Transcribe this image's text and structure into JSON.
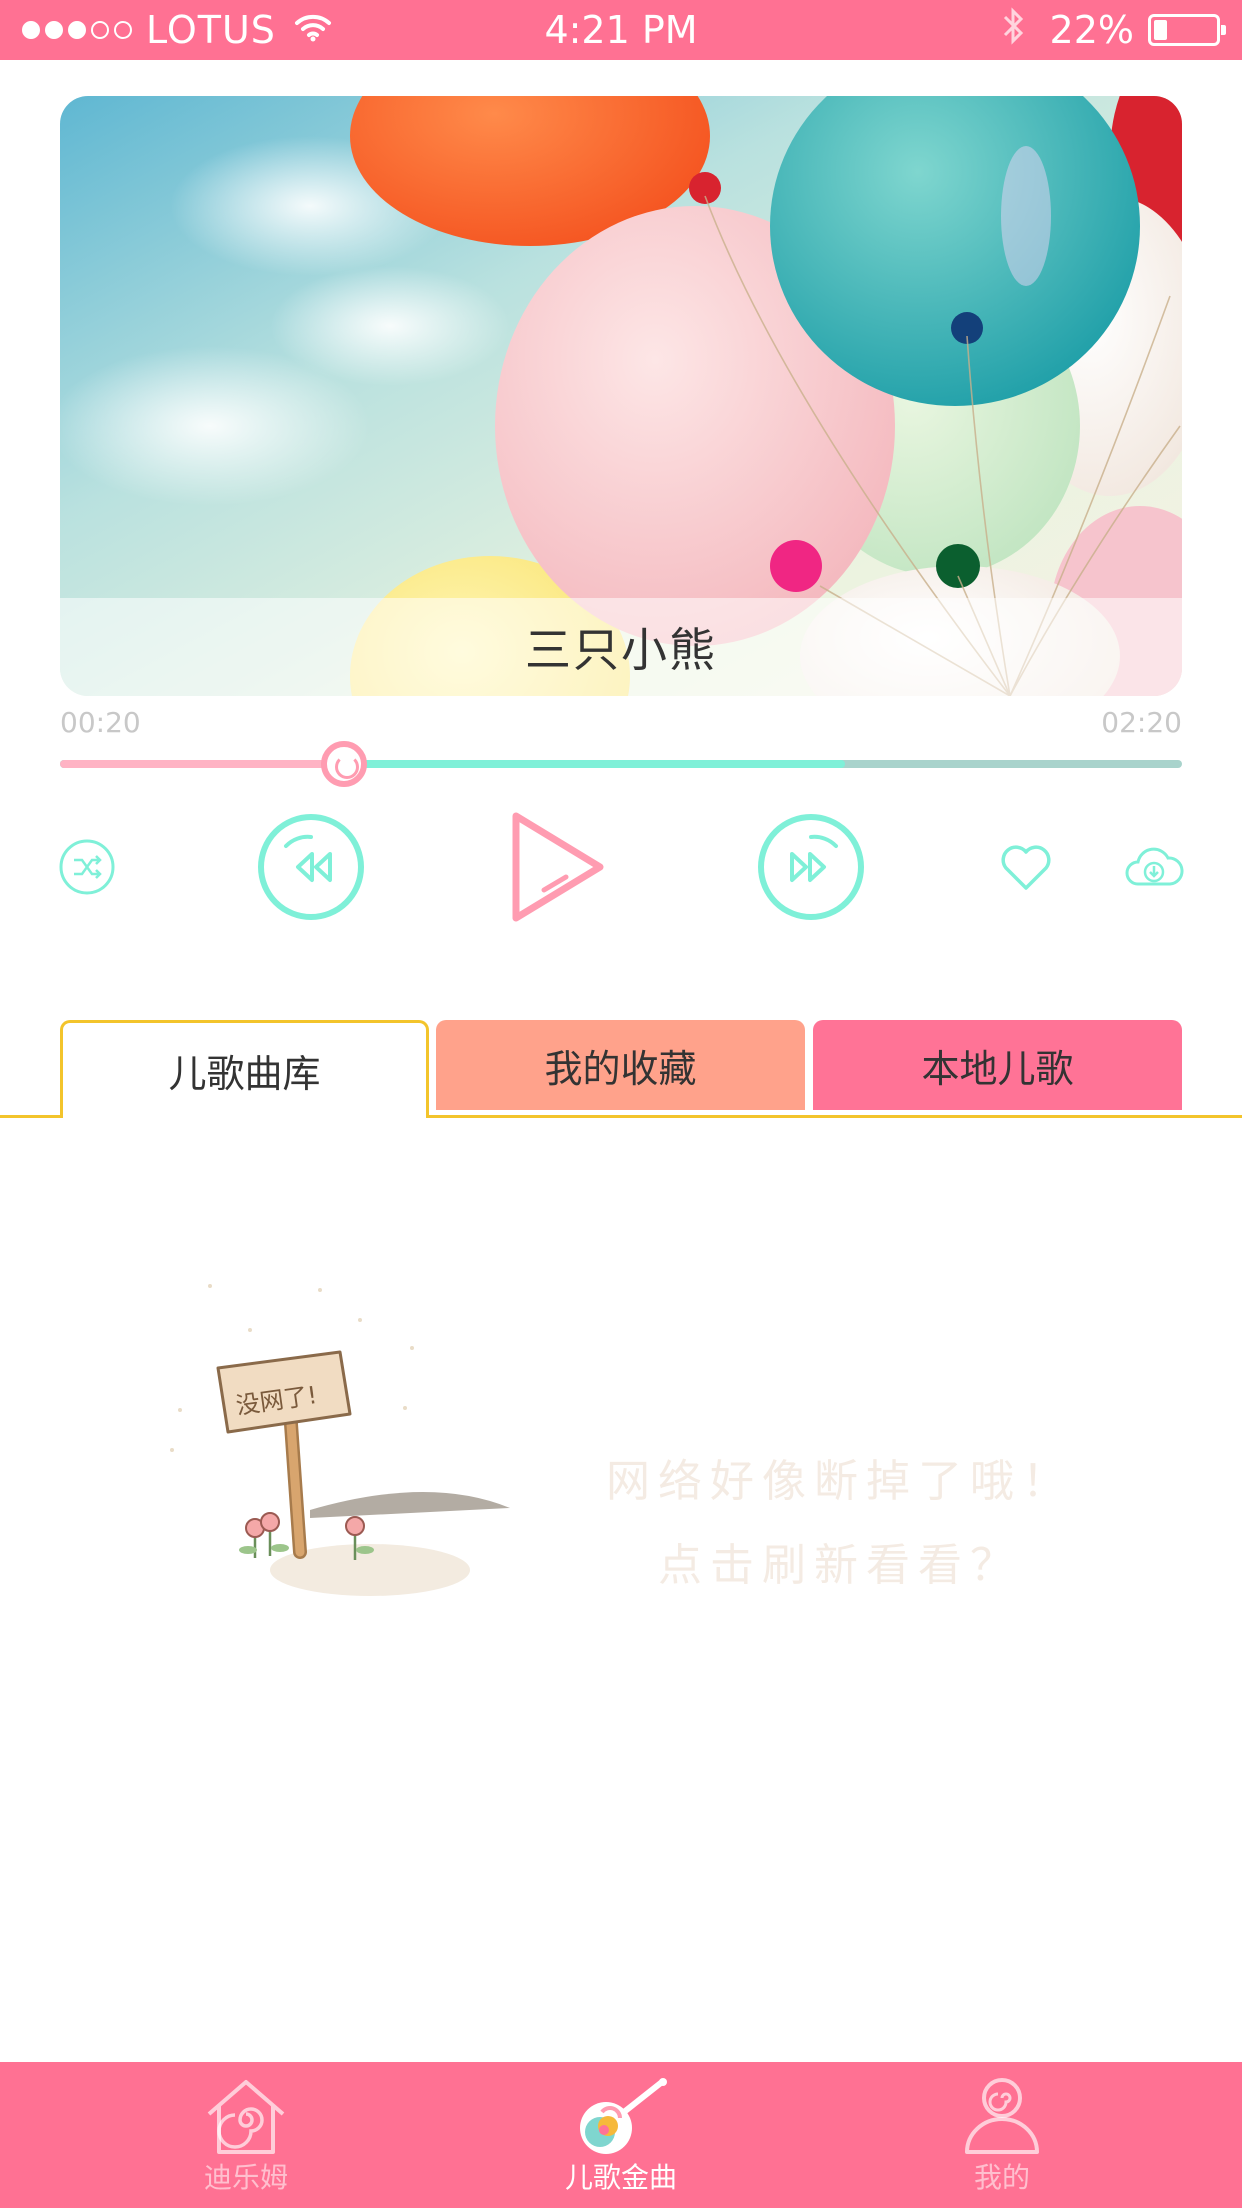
{
  "status_bar": {
    "carrier": "LOTUS",
    "time": "4:21 PM",
    "battery": "22%",
    "battery_level": 0.22,
    "signal_bars": 3
  },
  "player": {
    "title": "三只小熊",
    "current_time": "00:20",
    "total_time": "02:20",
    "played_fraction": 0.253,
    "buffered_fraction": 0.7,
    "colors": {
      "accent": "#7ff0d8",
      "pink": "#ff9cb1"
    }
  },
  "controls": {
    "shuffle": "shuffle-icon",
    "prev": "rewind-icon",
    "play": "play-icon",
    "next": "fast-forward-icon",
    "favorite": "heart-icon",
    "download": "cloud-download-icon"
  },
  "tabs": [
    {
      "label": "儿歌曲库",
      "active": true
    },
    {
      "label": "我的收藏",
      "active": false
    },
    {
      "label": "本地儿歌",
      "active": false
    }
  ],
  "empty_state": {
    "sign_text": "没网了!",
    "line1": "网络好像断掉了哦！",
    "line2": "点击刷新看看？"
  },
  "tabbar": {
    "items": [
      {
        "label": "迪乐姆",
        "icon": "house-icon",
        "active": false
      },
      {
        "label": "儿歌金曲",
        "icon": "guitar-icon",
        "active": true
      },
      {
        "label": "我的",
        "icon": "profile-icon",
        "active": false
      }
    ],
    "color": "#ff7193"
  }
}
